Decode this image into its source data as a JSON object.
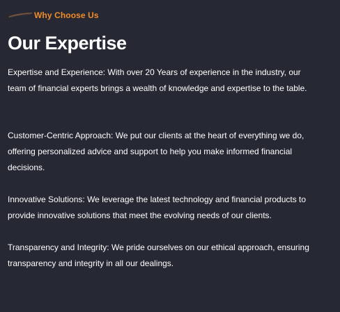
{
  "eyebrow": {
    "icon": "brush-stroke-icon",
    "label": "Why Choose Us",
    "accent_color": "#f28c28"
  },
  "title": "Our Expertise",
  "paragraphs": [
    "Expertise and Experience: With over 20 Years of experience in the industry, our team of financial experts brings a wealth of knowledge and expertise to the table.",
    "Customer-Centric Approach: We put our clients at the heart of everything we do, offering personalized advice and support to help you make informed financial decisions.",
    "Innovative Solutions: We leverage the latest technology and financial products to provide innovative solutions that meet the evolving needs of our clients.",
    "Transparency and Integrity: We pride ourselves on our ethical approach, ensuring transparency and integrity in all our dealings."
  ],
  "colors": {
    "background": "#262834",
    "text": "#ffffff"
  }
}
